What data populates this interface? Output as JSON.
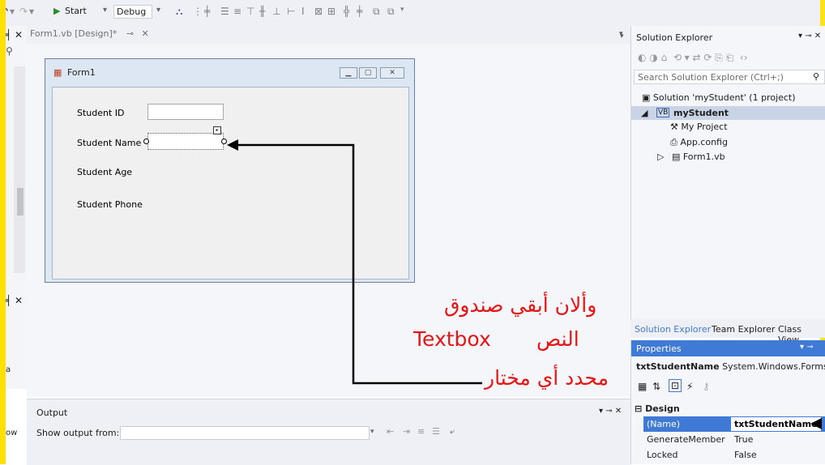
{
  "toolbar": {
    "start_label": "Start",
    "config_value": "Debug"
  },
  "left_panel": {
    "fragments": [
      "a",
      "ow"
    ]
  },
  "designer": {
    "tab_label": "Form1.vb [Design]*",
    "form": {
      "title": "Form1",
      "labels": [
        "Student ID",
        "Student Name",
        "Student Age",
        "Student Phone"
      ]
    }
  },
  "output": {
    "title": "Output",
    "show_from_label": "Show output from:"
  },
  "solution_explorer": {
    "title": "Solution Explorer",
    "search_placeholder": "Search Solution Explorer (Ctrl+;)",
    "items": [
      {
        "label": "Solution 'myStudent' (1 project)"
      },
      {
        "label": "myStudent"
      },
      {
        "label": "My Project"
      },
      {
        "label": "App.config"
      },
      {
        "label": "Form1.vb"
      }
    ],
    "tabs": [
      "Solution Explorer",
      "Team Explorer",
      "Class View"
    ]
  },
  "properties": {
    "title": "Properties",
    "object_name": "txtStudentName",
    "object_type": "System.Windows.Forms.Te",
    "category": "Design",
    "rows": [
      {
        "name": "(Name)",
        "value": "txtStudentName"
      },
      {
        "name": "GenerateMember",
        "value": "True"
      },
      {
        "name": "Locked",
        "value": "False"
      }
    ]
  },
  "annotation": {
    "lines": [
      "وألان أبقي صندوق",
      "النص",
      "Textbox",
      "محدد أي مختار"
    ],
    "color": "#e51515"
  },
  "colors": {
    "accent": "#3f7ad6",
    "highlight_bar": "#ffe000"
  }
}
